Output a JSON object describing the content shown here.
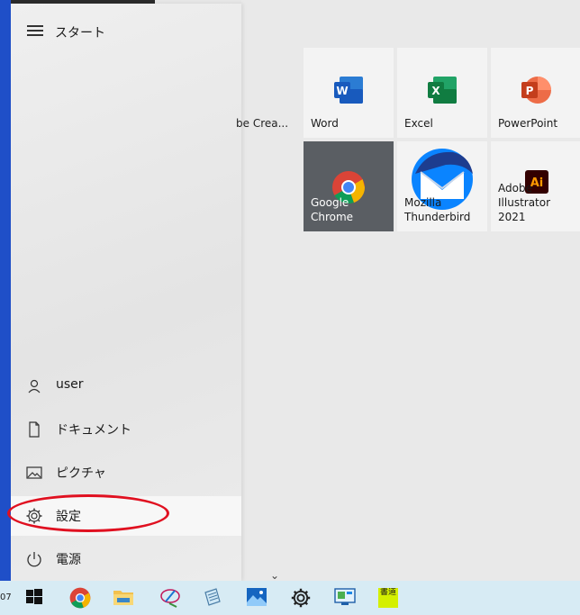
{
  "start_menu": {
    "title": "スタート",
    "nav": [
      {
        "label": "user",
        "icon": "user-icon"
      },
      {
        "label": "ドキュメント",
        "icon": "document-icon"
      },
      {
        "label": "ピクチャ",
        "icon": "pictures-icon"
      },
      {
        "label": "設定",
        "icon": "gear-icon"
      },
      {
        "label": "電源",
        "icon": "power-icon"
      }
    ],
    "highlighted": "設定"
  },
  "tiles": {
    "partial_label": "be Crea...",
    "items": [
      {
        "name": "Word",
        "icon": "word-icon",
        "color": "#185abd"
      },
      {
        "name": "Excel",
        "icon": "excel-icon",
        "color": "#107c41"
      },
      {
        "name": "PowerPoint",
        "icon": "powerpoint-icon",
        "color": "#c43e1c"
      },
      {
        "name": "Google Chrome",
        "icon": "chrome-icon",
        "color": "#5a5e63"
      },
      {
        "name": "Mozilla Thunderbird",
        "line1": "Mozilla",
        "line2": "Thunderbird",
        "icon": "thunderbird-icon",
        "color": "#0a84ff"
      },
      {
        "name": "Adobe Illustrator 2021",
        "line1": "Adobe",
        "line2": "Illustrator 2021",
        "icon": "illustrator-icon",
        "color": "#330000"
      }
    ]
  },
  "taskbar": {
    "clock_fragment": "07",
    "items": [
      "windows-start-icon",
      "chrome-icon",
      "file-explorer-icon",
      "paint-app-icon",
      "notepad-icon",
      "photos-icon",
      "settings-icon",
      "control-panel-icon",
      "calligraphy-app-icon"
    ],
    "calligraphy_text": "書道"
  },
  "colors": {
    "accent_red": "#e01020",
    "taskbar_bg": "#d7ebf4",
    "desktop_blue": "#1f4fc8"
  }
}
